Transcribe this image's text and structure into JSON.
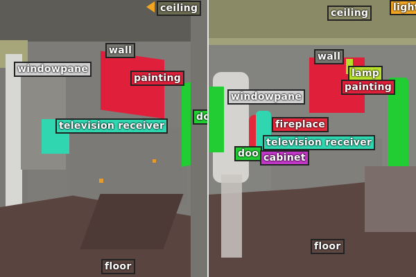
{
  "left_view": {
    "labels": {
      "ceiling": "ceiling",
      "wall": "wall",
      "windowpane": "windowpane",
      "painting": "painting",
      "television_receiver": "television receiver",
      "door_partial": "do",
      "floor": "floor"
    }
  },
  "right_view": {
    "labels": {
      "ceiling": "ceiling",
      "light_partial": "light",
      "wall": "wall",
      "lamp": "lamp",
      "painting": "painting",
      "windowpane": "windowpane",
      "fireplace": "fireplace",
      "television_receiver": "television receiver",
      "door_partial": "doo",
      "cabinet": "cabinet",
      "floor": "floor"
    }
  },
  "colors": {
    "ceiling": "#6b6b52",
    "wall": "#777771",
    "windowpane": "#cfcfcf",
    "painting": "#e0203a",
    "television_receiver": "#2fd6b0",
    "door": "#22cc33",
    "floor": "#5a4440",
    "fireplace": "#e3293b",
    "cabinet": "#c236c8",
    "lamp": "#b6e02c",
    "light": "#f2a520",
    "label_border": "#222222"
  }
}
